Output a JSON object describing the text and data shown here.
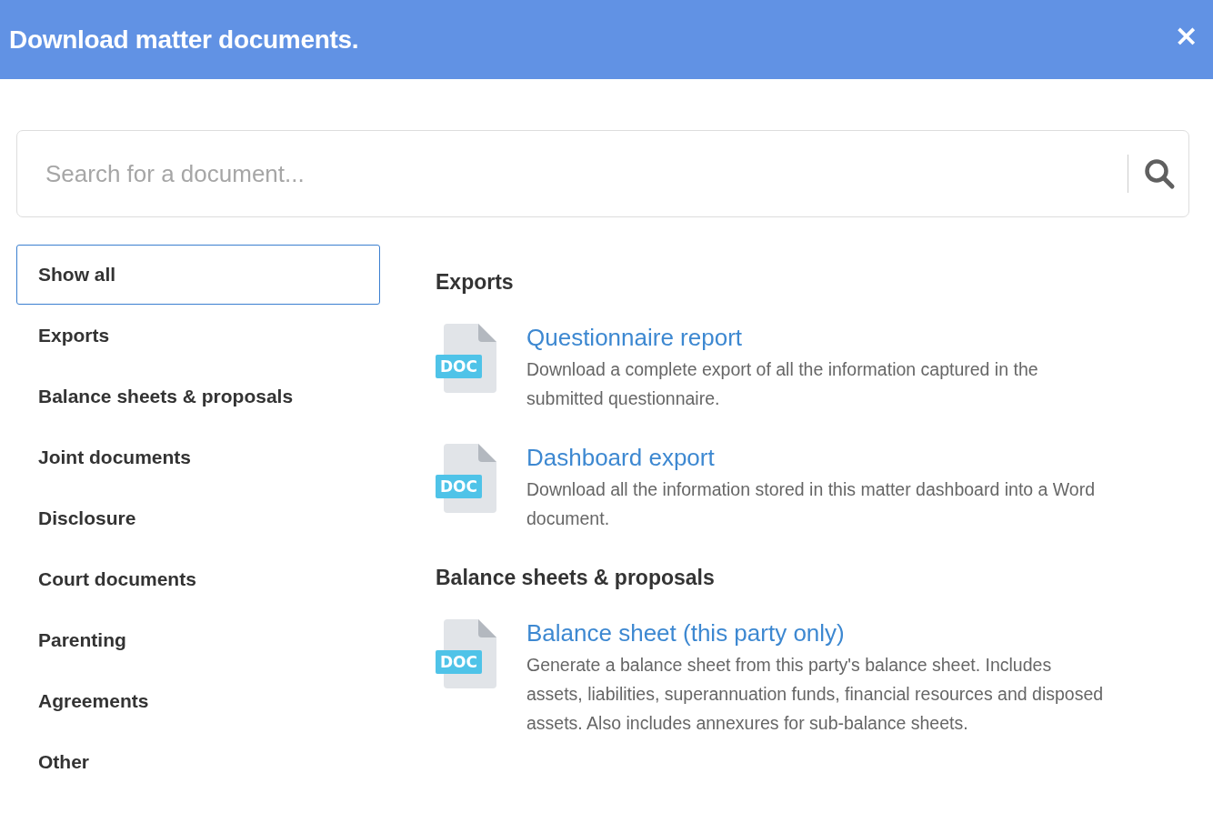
{
  "header": {
    "title": "Download matter documents.",
    "close": "×"
  },
  "search": {
    "placeholder": "Search for a document..."
  },
  "sidebar": {
    "items": [
      {
        "label": "Show all",
        "selected": true
      },
      {
        "label": "Exports",
        "selected": false
      },
      {
        "label": "Balance sheets & proposals",
        "selected": false
      },
      {
        "label": "Joint documents",
        "selected": false
      },
      {
        "label": "Disclosure",
        "selected": false
      },
      {
        "label": "Court documents",
        "selected": false
      },
      {
        "label": "Parenting",
        "selected": false
      },
      {
        "label": "Agreements",
        "selected": false
      },
      {
        "label": "Other",
        "selected": false
      }
    ]
  },
  "sections": [
    {
      "heading": "Exports",
      "documents": [
        {
          "badge": "DOC",
          "title": "Questionnaire report",
          "description": "Download a complete export of all the information captured in the submitted questionnaire."
        },
        {
          "badge": "DOC",
          "title": "Dashboard export",
          "description": "Download all the information stored in this matter dashboard into a Word document."
        }
      ]
    },
    {
      "heading": "Balance sheets & proposals",
      "documents": [
        {
          "badge": "DOC",
          "title": "Balance sheet (this party only)",
          "description": "Generate a balance sheet from this party's balance sheet. Includes assets, liabilities, superannuation funds, financial resources and disposed assets. Also includes annexures for sub-balance sheets."
        }
      ]
    }
  ]
}
